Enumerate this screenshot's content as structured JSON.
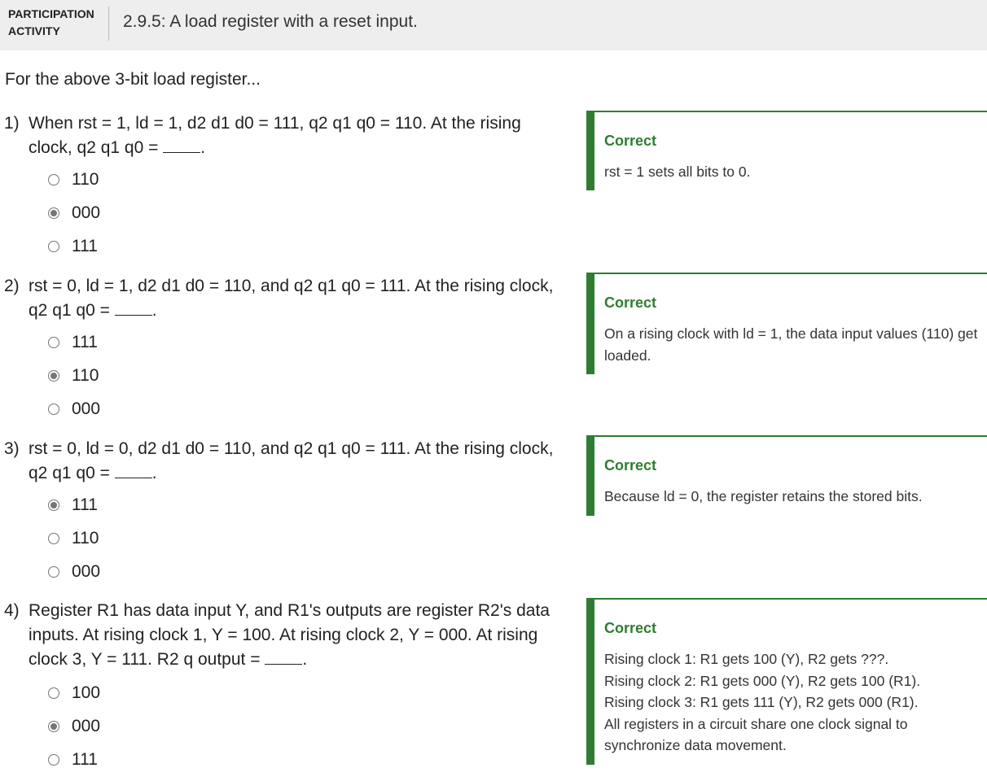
{
  "header": {
    "tag": "PARTICIPATION\nACTIVITY",
    "title": "2.9.5: A load register with a reset input."
  },
  "intro": "For the above 3-bit load register...",
  "questions": [
    {
      "number": "1)",
      "text": "When rst = 1, ld = 1, d2 d1 d0 = 111, q2 q1 q0 = 110. At the rising clock, q2 q1 q0 =",
      "options": [
        {
          "label": "110",
          "selected": false
        },
        {
          "label": "000",
          "selected": true
        },
        {
          "label": "111",
          "selected": false
        }
      ],
      "feedback": {
        "status": "Correct",
        "text": "rst = 1 sets all bits to 0."
      }
    },
    {
      "number": "2)",
      "text": "rst = 0, ld = 1, d2 d1 d0 = 110, and q2 q1 q0 = 111. At the rising clock, q2 q1 q0 =",
      "options": [
        {
          "label": "111",
          "selected": false
        },
        {
          "label": "110",
          "selected": true
        },
        {
          "label": "000",
          "selected": false
        }
      ],
      "feedback": {
        "status": "Correct",
        "text": "On a rising clock with ld = 1, the data input values (110) get loaded."
      }
    },
    {
      "number": "3)",
      "text": "rst = 0, ld = 0, d2 d1 d0 = 110, and q2 q1 q0 = 111. At the rising clock, q2 q1 q0 =",
      "options": [
        {
          "label": "111",
          "selected": true
        },
        {
          "label": "110",
          "selected": false
        },
        {
          "label": "000",
          "selected": false
        }
      ],
      "feedback": {
        "status": "Correct",
        "text": "Because ld = 0, the register retains the stored bits."
      }
    },
    {
      "number": "4)",
      "text": "Register R1 has data input Y, and R1's outputs are register R2's data inputs. At rising clock 1, Y = 100. At rising clock 2, Y = 000. At rising clock 3, Y = 111. R2 q output =",
      "options": [
        {
          "label": "100",
          "selected": false
        },
        {
          "label": "000",
          "selected": true
        },
        {
          "label": "111",
          "selected": false
        }
      ],
      "feedback": {
        "status": "Correct",
        "text": "Rising clock 1: R1 gets 100 (Y), R2 gets ???.\nRising clock 2: R1 gets 000 (Y), R2 gets 100 (R1).\nRising clock 3: R1 gets 111 (Y), R2 gets 000 (R1).\nAll registers in a circuit share one clock signal to synchronize data movement."
      }
    }
  ],
  "colors": {
    "correct": "#2e7d32",
    "header_bg": "#eeeeee",
    "radio": "#757575"
  }
}
